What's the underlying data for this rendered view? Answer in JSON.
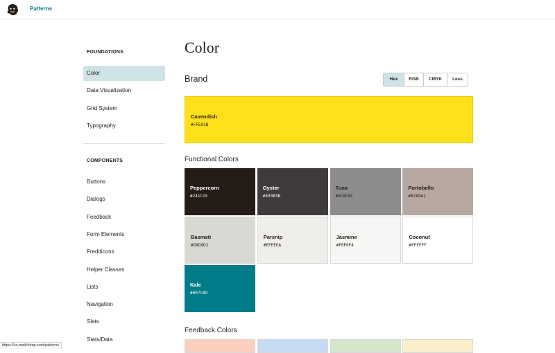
{
  "topbar": {
    "logo_icon": "freddie-logo-icon",
    "link": "Patterns"
  },
  "sidebar": {
    "foundations_heading": "FOUNDATIONS",
    "foundations": [
      {
        "label": "Color",
        "active": true
      },
      {
        "label": "Data Visualization"
      },
      {
        "label": "Grid System"
      },
      {
        "label": "Typography"
      }
    ],
    "components_heading": "COMPONENTS",
    "components": [
      {
        "label": "Buttons"
      },
      {
        "label": "Dialogs"
      },
      {
        "label": "Feedback"
      },
      {
        "label": "Form Elements"
      },
      {
        "label": "Freddicons"
      },
      {
        "label": "Helper Classes"
      },
      {
        "label": "Lists"
      },
      {
        "label": "Navigation"
      },
      {
        "label": "Slats"
      },
      {
        "label": "Stats/Data"
      }
    ]
  },
  "main": {
    "title": "Color",
    "brand_heading": "Brand",
    "format_toggle": [
      {
        "label": "Hex",
        "active": true
      },
      {
        "label": "RGB"
      },
      {
        "label": "CMYK"
      },
      {
        "label": "Less"
      }
    ],
    "brand_color": {
      "name": "Cavendish",
      "hex": "#FFE01B",
      "color": "#FFE01B",
      "text": "#241C15"
    },
    "functional_heading": "Functional Colors",
    "functional_colors": [
      {
        "name": "Peppercorn",
        "hex": "#241C15",
        "color": "#241C15",
        "text": "#FFFFFF"
      },
      {
        "name": "Oyster",
        "hex": "#403B3B",
        "color": "#403B3B",
        "text": "#FFFFFF"
      },
      {
        "name": "Tuna",
        "hex": "#8C8C8C",
        "color": "#8C8C8C",
        "text": "#241C15"
      },
      {
        "name": "Portobello",
        "hex": "#B7A9A1",
        "color": "#B7A9A1",
        "text": "#241C15"
      },
      {
        "name": "Basmati",
        "hex": "#D8D9D2",
        "color": "#D8D9D2",
        "text": "#241C15"
      },
      {
        "name": "Parsnip",
        "hex": "#EFEEEA",
        "color": "#EFEEEA",
        "text": "#241C15"
      },
      {
        "name": "Jasmine",
        "hex": "#F6F6F4",
        "color": "#F6F6F4",
        "text": "#241C15"
      },
      {
        "name": "Coconut",
        "hex": "#FFFFFF",
        "color": "#FFFFFF",
        "text": "#241C15"
      },
      {
        "name": "Kale",
        "hex": "#007C89",
        "color": "#007C89",
        "text": "#FFFFFF"
      }
    ],
    "feedback_heading": "Feedback Colors",
    "feedback_colors": [
      {
        "color": "#FBCFBD"
      },
      {
        "color": "#C5DBF2"
      },
      {
        "color": "#D4E6CB"
      },
      {
        "color": "#FBEECA"
      }
    ]
  },
  "status_url": "https://ux.mailchimp.com/patterns"
}
